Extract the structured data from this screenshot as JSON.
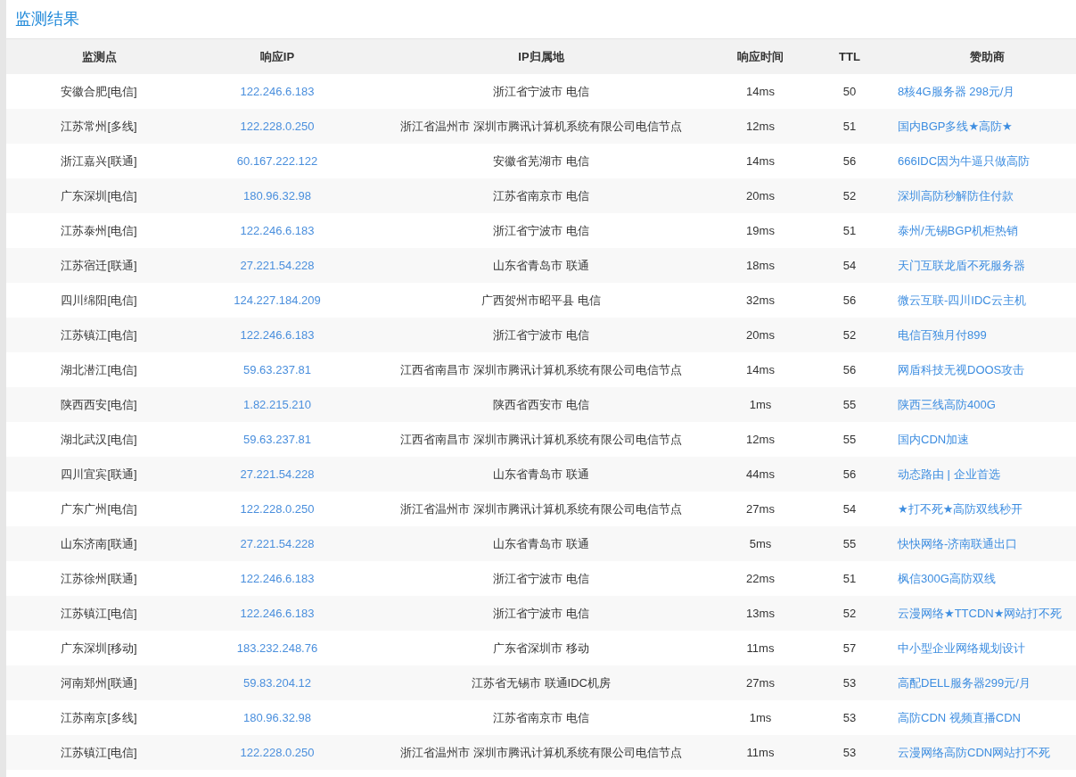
{
  "title": "监测结果",
  "table": {
    "columns": [
      "监测点",
      "响应IP",
      "IP归属地",
      "响应时间",
      "TTL",
      "赞助商"
    ],
    "rows": [
      {
        "location": "安徽合肥[电信]",
        "ip": "122.246.6.183",
        "ip_location": "浙江省宁波市 电信",
        "time": "14ms",
        "ttl": "50",
        "sponsor": "8核4G服务器 298元/月"
      },
      {
        "location": "江苏常州[多线]",
        "ip": "122.228.0.250",
        "ip_location": "浙江省温州市 深圳市腾讯计算机系统有限公司电信节点",
        "time": "12ms",
        "ttl": "51",
        "sponsor": "国内BGP多线★高防★"
      },
      {
        "location": "浙江嘉兴[联通]",
        "ip": "60.167.222.122",
        "ip_location": "安徽省芜湖市 电信",
        "time": "14ms",
        "ttl": "56",
        "sponsor": "666IDC因为牛逼只做高防"
      },
      {
        "location": "广东深圳[电信]",
        "ip": "180.96.32.98",
        "ip_location": "江苏省南京市 电信",
        "time": "20ms",
        "ttl": "52",
        "sponsor": "深圳高防秒解防住付款"
      },
      {
        "location": "江苏泰州[电信]",
        "ip": "122.246.6.183",
        "ip_location": "浙江省宁波市 电信",
        "time": "19ms",
        "ttl": "51",
        "sponsor": "泰州/无锡BGP机柜热销"
      },
      {
        "location": "江苏宿迁[联通]",
        "ip": "27.221.54.228",
        "ip_location": "山东省青岛市 联通",
        "time": "18ms",
        "ttl": "54",
        "sponsor": "天门互联龙盾不死服务器"
      },
      {
        "location": "四川绵阳[电信]",
        "ip": "124.227.184.209",
        "ip_location": "广西贺州市昭平县 电信",
        "time": "32ms",
        "ttl": "56",
        "sponsor": "微云互联-四川IDC云主机"
      },
      {
        "location": "江苏镇江[电信]",
        "ip": "122.246.6.183",
        "ip_location": "浙江省宁波市 电信",
        "time": "20ms",
        "ttl": "52",
        "sponsor": "电信百独月付899"
      },
      {
        "location": "湖北潜江[电信]",
        "ip": "59.63.237.81",
        "ip_location": "江西省南昌市 深圳市腾讯计算机系统有限公司电信节点",
        "time": "14ms",
        "ttl": "56",
        "sponsor": "网盾科技无视DOOS攻击"
      },
      {
        "location": "陕西西安[电信]",
        "ip": "1.82.215.210",
        "ip_location": "陕西省西安市 电信",
        "time": "1ms",
        "ttl": "55",
        "sponsor": "陕西三线高防400G"
      },
      {
        "location": "湖北武汉[电信]",
        "ip": "59.63.237.81",
        "ip_location": "江西省南昌市 深圳市腾讯计算机系统有限公司电信节点",
        "time": "12ms",
        "ttl": "55",
        "sponsor": "国内CDN加速"
      },
      {
        "location": "四川宜宾[联通]",
        "ip": "27.221.54.228",
        "ip_location": "山东省青岛市 联通",
        "time": "44ms",
        "ttl": "56",
        "sponsor": "动态路由 | 企业首选"
      },
      {
        "location": "广东广州[电信]",
        "ip": "122.228.0.250",
        "ip_location": "浙江省温州市 深圳市腾讯计算机系统有限公司电信节点",
        "time": "27ms",
        "ttl": "54",
        "sponsor": "★打不死★高防双线秒开"
      },
      {
        "location": "山东济南[联通]",
        "ip": "27.221.54.228",
        "ip_location": "山东省青岛市 联通",
        "time": "5ms",
        "ttl": "55",
        "sponsor": "快快网络-济南联通出口"
      },
      {
        "location": "江苏徐州[联通]",
        "ip": "122.246.6.183",
        "ip_location": "浙江省宁波市 电信",
        "time": "22ms",
        "ttl": "51",
        "sponsor": "枫信300G高防双线"
      },
      {
        "location": "江苏镇江[电信]",
        "ip": "122.246.6.183",
        "ip_location": "浙江省宁波市 电信",
        "time": "13ms",
        "ttl": "52",
        "sponsor": "云漫网络★TTCDN★网站打不死"
      },
      {
        "location": "广东深圳[移动]",
        "ip": "183.232.248.76",
        "ip_location": "广东省深圳市 移动",
        "time": "11ms",
        "ttl": "57",
        "sponsor": "中小型企业网络规划设计"
      },
      {
        "location": "河南郑州[联通]",
        "ip": "59.83.204.12",
        "ip_location": "江苏省无锡市 联通IDC机房",
        "time": "27ms",
        "ttl": "53",
        "sponsor": "高配DELL服务器299元/月"
      },
      {
        "location": "江苏南京[多线]",
        "ip": "180.96.32.98",
        "ip_location": "江苏省南京市 电信",
        "time": "1ms",
        "ttl": "53",
        "sponsor": "高防CDN 视频直播CDN"
      },
      {
        "location": "江苏镇江[电信]",
        "ip": "122.228.0.250",
        "ip_location": "浙江省温州市 深圳市腾讯计算机系统有限公司电信节点",
        "time": "11ms",
        "ttl": "53",
        "sponsor": "云漫网络高防CDN网站打不死"
      }
    ]
  }
}
